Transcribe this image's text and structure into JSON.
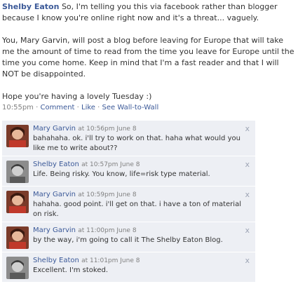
{
  "post": {
    "author": "Shelby Eaton",
    "text1": "So, I'm telling you this via facebook rather than blogger because I know you're online right now and it's a threat... vaguely.",
    "text2": "You, Mary Garvin, will post a blog before leaving for Europe that will take me the amount of time to read from the time you leave for Europe until the time you come home. Keep in mind that I'm a fast reader and that I will NOT be disappointed.",
    "text3": "Hope you're having a lovely Tuesday :)",
    "time": "10:55pm",
    "sep": " · ",
    "comment_link": "Comment",
    "like_link": "Like",
    "wall_link": "See Wall-to-Wall"
  },
  "comments": [
    {
      "author": "Mary Garvin",
      "time": "at 10:56pm June 8",
      "text": "bahahaha. ok. i'll try to work on that. haha what would you like me to write about??",
      "avatar_icon": "mary-photo-icon"
    },
    {
      "author": "Shelby Eaton",
      "time": "at 10:57pm June 8",
      "text": "Life. Being risky. You know, life=risk type material.",
      "avatar_icon": "shelby-photo-icon"
    },
    {
      "author": "Mary Garvin",
      "time": "at 10:59pm June 8",
      "text": "hahaha. good point. i'll get on that. i have a ton of material on risk.",
      "avatar_icon": "mary-photo-icon"
    },
    {
      "author": "Mary Garvin",
      "time": "at 11:00pm June 8",
      "text": "by the way, i'm going to call it The Shelby Eaton Blog.",
      "avatar_icon": "mary-photo-icon"
    },
    {
      "author": "Shelby Eaton",
      "time": "at 11:01pm June 8",
      "text": "Excellent. I'm stoked.",
      "avatar_icon": "shelby-photo-icon"
    }
  ],
  "close_glyph": "x",
  "colors": {
    "link": "#3b5998",
    "comment_bg": "#edeff4",
    "meta": "#808080"
  }
}
